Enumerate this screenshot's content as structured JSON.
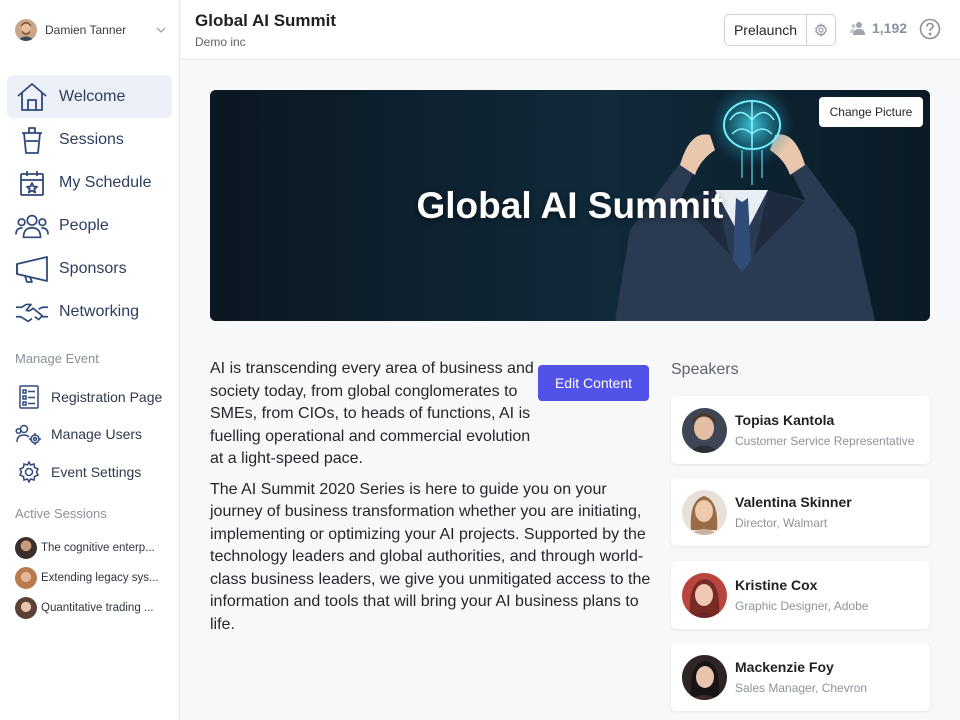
{
  "user": {
    "name": "Damien Tanner"
  },
  "sidebar": {
    "nav": [
      {
        "label": "Welcome",
        "icon": "home-icon"
      },
      {
        "label": "Sessions",
        "icon": "podium-icon"
      },
      {
        "label": "My Schedule",
        "icon": "calendar-star-icon"
      },
      {
        "label": "People",
        "icon": "people-icon"
      },
      {
        "label": "Sponsors",
        "icon": "megaphone-icon"
      },
      {
        "label": "Networking",
        "icon": "handshake-icon"
      }
    ],
    "manage_title": "Manage Event",
    "manage": [
      {
        "label": "Registration Page",
        "icon": "form-icon"
      },
      {
        "label": "Manage Users",
        "icon": "users-gear-icon"
      },
      {
        "label": "Event Settings",
        "icon": "gear-icon"
      }
    ],
    "sessions_title": "Active Sessions",
    "sessions": [
      {
        "label": "The cognitive enterp..."
      },
      {
        "label": "Extending legacy sys..."
      },
      {
        "label": "Quantitative trading ..."
      }
    ]
  },
  "header": {
    "title": "Global AI Summit",
    "org": "Demo inc",
    "prelaunch_label": "Prelaunch",
    "attendee_count": "1,192"
  },
  "banner": {
    "title": "Global AI Summit",
    "change_label": "Change Picture"
  },
  "content": {
    "paragraph1": "AI is transcending every area of business and society today, from global conglomerates to SMEs, from CIOs, to heads of functions, AI is fuelling operational and commercial evolution at a light-speed pace.",
    "paragraph2": "The AI Summit 2020 Series is here to guide you on your journey of business transformation whether you are initiating, implementing or optimizing your AI projects. Supported by the technology leaders and global authorities, and through world-class business leaders, we give you unmitigated access to the information and tools that will bring your AI business plans to life.",
    "edit_label": "Edit Content"
  },
  "speakers": {
    "title": "Speakers",
    "items": [
      {
        "name": "Topias Kantola",
        "role": "Customer Service Representative"
      },
      {
        "name": "Valentina Skinner",
        "role": "Director, Walmart"
      },
      {
        "name": "Kristine Cox",
        "role": "Graphic Designer, Adobe"
      },
      {
        "name": "Mackenzie Foy",
        "role": "Sales Manager, Chevron"
      }
    ]
  },
  "colors": {
    "accent": "#5352e8",
    "nav_text": "#2c3e5f",
    "active_bg": "#eef0f8"
  }
}
